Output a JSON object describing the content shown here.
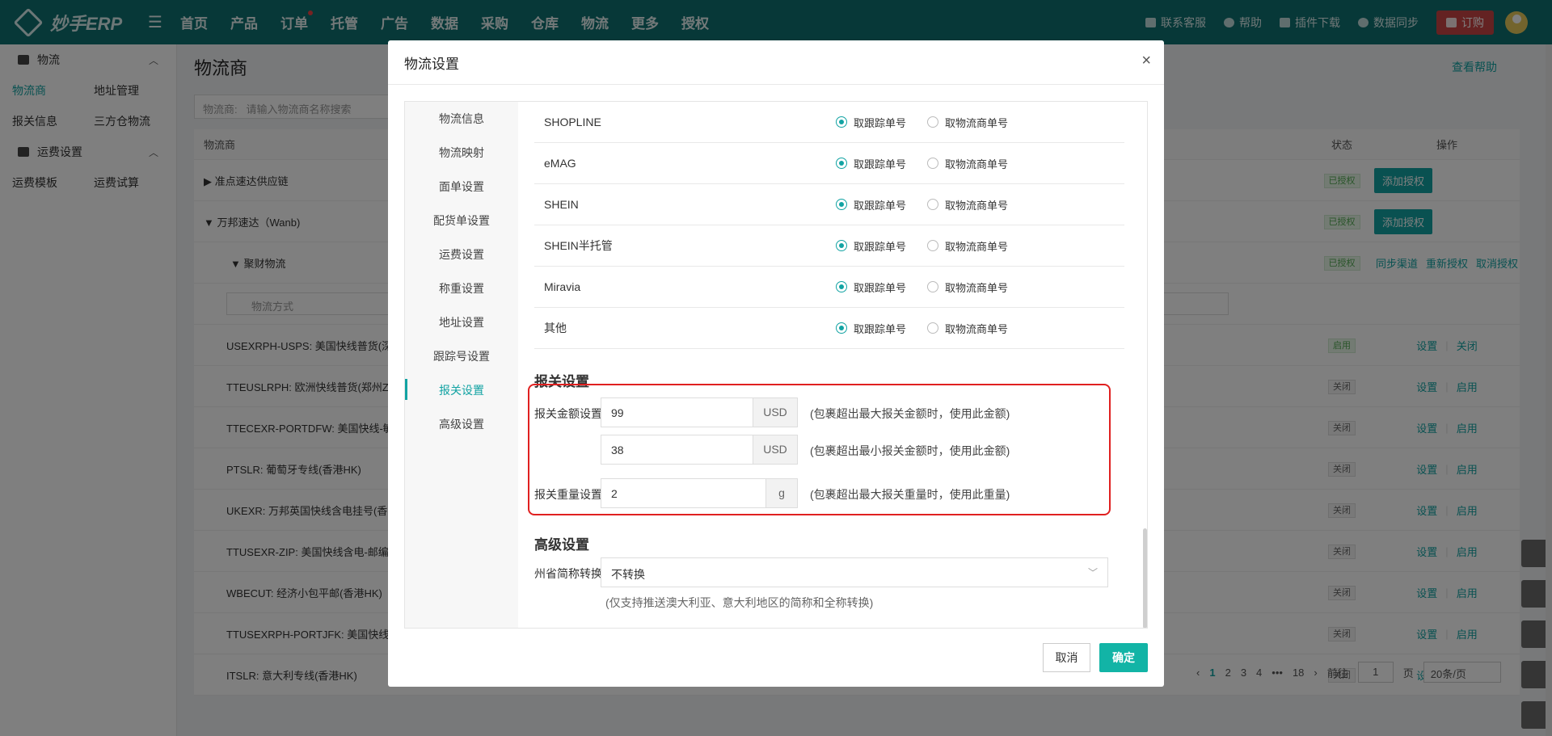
{
  "topbar": {
    "logo": "妙手ERP",
    "nav": [
      "首页",
      "产品",
      "订单",
      "托管",
      "广告",
      "数据",
      "采购",
      "仓库",
      "物流",
      "更多",
      "授权"
    ],
    "right": {
      "service": "联系客服",
      "help": "帮助",
      "plugin": "插件下载",
      "sync": "数据同步",
      "order": "订购"
    }
  },
  "sidebar": {
    "group1": "物流",
    "row1": [
      "物流商",
      "地址管理"
    ],
    "row2": [
      "报关信息",
      "三方仓物流"
    ],
    "group2": "运费设置",
    "row3": [
      "运费模板",
      "运费试算"
    ]
  },
  "main": {
    "title": "物流商",
    "help": "查看帮助",
    "search_label": "物流商:",
    "search_placeholder": "请输入物流商名称搜索",
    "col_name": "物流商",
    "col_status": "状态",
    "col_op": "操作",
    "rows": [
      {
        "name": "▶ 准点速达供应链",
        "status": "已授权",
        "op": "添加授权"
      },
      {
        "name": "▼ 万邦速达（Wanb)",
        "status": "已授权",
        "op": "添加授权"
      },
      {
        "name": "▼ 聚财物流",
        "status": "已授权",
        "ops": [
          "同步渠道",
          "重新授权",
          "取消授权"
        ]
      },
      {
        "name": "",
        "status": "",
        "op": ""
      },
      {
        "name": "USEXRPH-USPS: 美国快线普货(深",
        "status": "启用",
        "ops": [
          "设置",
          "关闭"
        ]
      },
      {
        "name": "TTEUSLRPH: 欧洲快线普货(郑州Z",
        "status": "关闭",
        "ops": [
          "设置",
          "启用"
        ]
      },
      {
        "name": "TTECEXR-PORTDFW: 美国快线-敏",
        "status": "关闭",
        "ops": [
          "设置",
          "启用"
        ]
      },
      {
        "name": "PTSLR: 葡萄牙专线(香港HK)",
        "status": "关闭",
        "ops": [
          "设置",
          "启用"
        ]
      },
      {
        "name": "UKEXR: 万邦英国快线含电挂号(香",
        "status": "关闭",
        "ops": [
          "设置",
          "启用"
        ]
      },
      {
        "name": "TTUSEXR-ZIP: 美国快线含电-邮编",
        "status": "关闭",
        "ops": [
          "设置",
          "启用"
        ]
      },
      {
        "name": "WBECUT: 经济小包平邮(香港HK)",
        "status": "关闭",
        "ops": [
          "设置",
          "启用"
        ]
      },
      {
        "name": "TTUSEXRPH-PORTJFK: 美国快线-",
        "status": "关闭",
        "ops": [
          "设置",
          "启用"
        ]
      },
      {
        "name": "ITSLR: 意大利专线(香港HK)",
        "status": "关闭",
        "ops": [
          "设置",
          "启用"
        ]
      }
    ],
    "method_placeholder": "物流方式",
    "pager": {
      "pages": [
        "1",
        "2",
        "3",
        "4",
        "•••",
        "18"
      ],
      "goto": "前往",
      "page_value": "1",
      "page_unit": "页",
      "size": "20条/页"
    }
  },
  "modal": {
    "title": "物流设置",
    "close": "×",
    "nav": [
      "物流信息",
      "物流映射",
      "面单设置",
      "配货单设置",
      "运费设置",
      "称重设置",
      "地址设置",
      "跟踪号设置",
      "报关设置",
      "高级设置"
    ],
    "platforms": [
      {
        "name": "SHOPLINE"
      },
      {
        "name": "eMAG"
      },
      {
        "name": "SHEIN"
      },
      {
        "name": "SHEIN半托管"
      },
      {
        "name": "Miravia"
      },
      {
        "name": "其他"
      }
    ],
    "opt_tracking": "取跟踪单号",
    "opt_logistics": "取物流商单号",
    "customs": {
      "title": "报关设置",
      "amount_label": "报关金额设置:",
      "max_amount": "99",
      "min_amount": "38",
      "currency": "USD",
      "max_note": "(包裹超出最大报关金额时，使用此金额)",
      "min_note": "(包裹超出最小报关金额时，使用此金额)",
      "weight_label": "报关重量设置:",
      "weight": "2",
      "weight_unit": "g",
      "weight_note": "(包裹超出最大报关重量时，使用此重量)"
    },
    "advanced": {
      "title": "高级设置",
      "state_label": "州省简称转换:",
      "state_value": "不转换",
      "state_note": "(仅支持推送澳大利亚、意大利地区的简称和全称转换)"
    },
    "cancel": "取消",
    "ok": "确定"
  }
}
